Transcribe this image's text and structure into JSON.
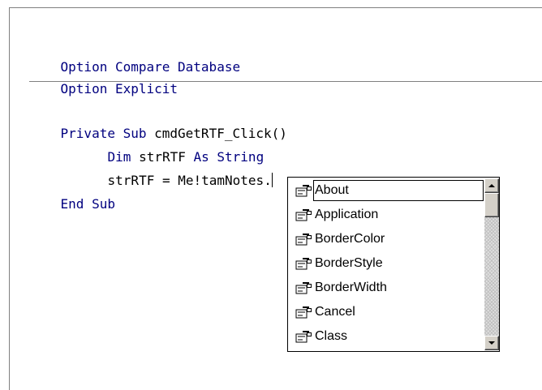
{
  "code": {
    "line1": {
      "kw": "Option Compare Database"
    },
    "line2": {
      "kw": "Option Explicit"
    },
    "line3": {
      "kw": "Private Sub",
      "rest": " cmdGetRTF_Click()"
    },
    "line4": {
      "kw1": "Dim",
      "mid": " strRTF ",
      "kw2": "As String"
    },
    "line5": {
      "text": "strRTF = Me!tamNotes."
    },
    "line6": {
      "kw": "End Sub"
    }
  },
  "autocomplete": {
    "items": [
      {
        "label": "About",
        "icon": "property-icon",
        "selected": true
      },
      {
        "label": "Application",
        "icon": "property-icon"
      },
      {
        "label": "BorderColor",
        "icon": "property-icon"
      },
      {
        "label": "BorderStyle",
        "icon": "property-icon"
      },
      {
        "label": "BorderWidth",
        "icon": "property-icon"
      },
      {
        "label": "Cancel",
        "icon": "property-icon"
      },
      {
        "label": "Class",
        "icon": "property-icon"
      }
    ]
  },
  "colors": {
    "keyword": "#00007f",
    "text": "#000000",
    "separator": "#808080"
  }
}
